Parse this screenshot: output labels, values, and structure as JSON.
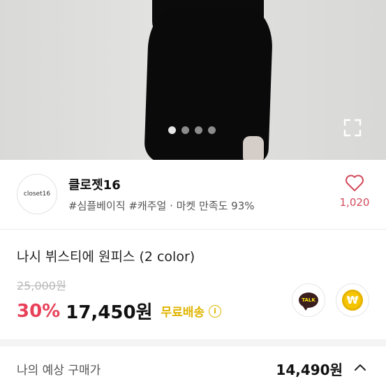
{
  "hero": {
    "carousel_total": 4,
    "carousel_active": 1,
    "expand_icon": "expand-icon"
  },
  "seller": {
    "avatar_text": "closet16",
    "name": "클로젯16",
    "tags": "#심플베이직 #캐주얼 · 마켓 만족도 93%",
    "like_icon": "heart-outline-icon",
    "like_count": "1,020"
  },
  "product": {
    "title": "나시 뷔스티에 원피스 (2 color)",
    "original_price": "25,000원",
    "discount": "30%",
    "sale_price": "17,450원",
    "shipping": "무료배송",
    "info_icon": "i",
    "talk_label": "TALK",
    "pay_label": "₩"
  },
  "estimate": {
    "label": "나의 예상 구매가",
    "price": "14,490원",
    "toggle_icon": "chevron-up-icon"
  },
  "colors": {
    "accent_red": "#e8425a",
    "shipping_yellow": "#e0b400",
    "heart": "#d24a5c"
  }
}
